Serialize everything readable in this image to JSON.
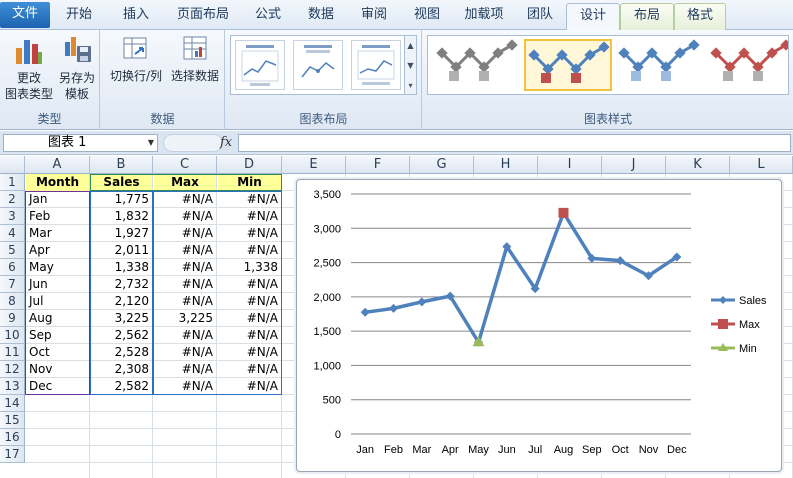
{
  "ribbon": {
    "tabs": [
      {
        "label": "文件",
        "kind": "file"
      },
      {
        "label": "开始",
        "kind": "normal"
      },
      {
        "label": "插入",
        "kind": "normal"
      },
      {
        "label": "页面布局",
        "kind": "normal"
      },
      {
        "label": "公式",
        "kind": "normal"
      },
      {
        "label": "数据",
        "kind": "normal"
      },
      {
        "label": "审阅",
        "kind": "normal"
      },
      {
        "label": "视图",
        "kind": "normal"
      },
      {
        "label": "加载项",
        "kind": "normal"
      },
      {
        "label": "团队",
        "kind": "normal"
      },
      {
        "label": "设计",
        "kind": "active"
      },
      {
        "label": "布局",
        "kind": "ctx"
      },
      {
        "label": "格式",
        "kind": "ctx"
      }
    ],
    "groups": {
      "type": {
        "label": "类型",
        "change_type": {
          "line1": "更改",
          "line2": "图表类型"
        },
        "save_template": {
          "line1": "另存为",
          "line2": "模板"
        }
      },
      "data": {
        "label": "数据",
        "switch_row_col": "切换行/列",
        "select_data": "选择数据"
      },
      "layouts": {
        "label": "图表布局"
      },
      "styles": {
        "label": "图表样式"
      }
    },
    "style_colors": [
      "#7f7f7f",
      "#4f81bd",
      "#4f81bd",
      "#c0504d"
    ]
  },
  "formula_bar": {
    "name_box": "图表 1",
    "fx": "fx",
    "formula": ""
  },
  "sheet": {
    "columns": [
      "A",
      "B",
      "C",
      "D",
      "E",
      "F",
      "G",
      "H",
      "I",
      "J",
      "K",
      "L"
    ],
    "rows": [
      "1",
      "2",
      "3",
      "4",
      "5",
      "6",
      "7",
      "8",
      "9",
      "10",
      "11",
      "12",
      "13",
      "14",
      "15",
      "16",
      "17"
    ],
    "header": [
      "Month",
      "Sales",
      "Max",
      "Min"
    ],
    "data": [
      [
        "Jan",
        "1,775",
        "#N/A",
        "#N/A"
      ],
      [
        "Feb",
        "1,832",
        "#N/A",
        "#N/A"
      ],
      [
        "Mar",
        "1,927",
        "#N/A",
        "#N/A"
      ],
      [
        "Apr",
        "2,011",
        "#N/A",
        "#N/A"
      ],
      [
        "May",
        "1,338",
        "#N/A",
        "1,338"
      ],
      [
        "Jun",
        "2,732",
        "#N/A",
        "#N/A"
      ],
      [
        "Jul",
        "2,120",
        "#N/A",
        "#N/A"
      ],
      [
        "Aug",
        "3,225",
        "3,225",
        "#N/A"
      ],
      [
        "Sep",
        "2,562",
        "#N/A",
        "#N/A"
      ],
      [
        "Oct",
        "2,528",
        "#N/A",
        "#N/A"
      ],
      [
        "Nov",
        "2,308",
        "#N/A",
        "#N/A"
      ],
      [
        "Dec",
        "2,582",
        "#N/A",
        "#N/A"
      ]
    ]
  },
  "chart_data": {
    "type": "line",
    "categories": [
      "Jan",
      "Feb",
      "Mar",
      "Apr",
      "May",
      "Jun",
      "Jul",
      "Aug",
      "Sep",
      "Oct",
      "Nov",
      "Dec"
    ],
    "series": [
      {
        "name": "Sales",
        "values": [
          1775,
          1832,
          1927,
          2011,
          1338,
          2732,
          2120,
          3225,
          2562,
          2528,
          2308,
          2582
        ],
        "color": "#4f81bd",
        "marker": "diamond"
      },
      {
        "name": "Max",
        "values": [
          null,
          null,
          null,
          null,
          null,
          null,
          null,
          3225,
          null,
          null,
          null,
          null
        ],
        "color": "#c0504d",
        "marker": "square"
      },
      {
        "name": "Min",
        "values": [
          null,
          null,
          null,
          null,
          1338,
          null,
          null,
          null,
          null,
          null,
          null,
          null
        ],
        "color": "#9bbb59",
        "marker": "triangle"
      }
    ],
    "yticks": [
      "0",
      "500",
      "1,000",
      "1,500",
      "2,000",
      "2,500",
      "3,000",
      "3,500"
    ],
    "ylim": [
      0,
      3500
    ],
    "grid": true,
    "legend_position": "right",
    "title": "",
    "xlabel": "",
    "ylabel": ""
  }
}
